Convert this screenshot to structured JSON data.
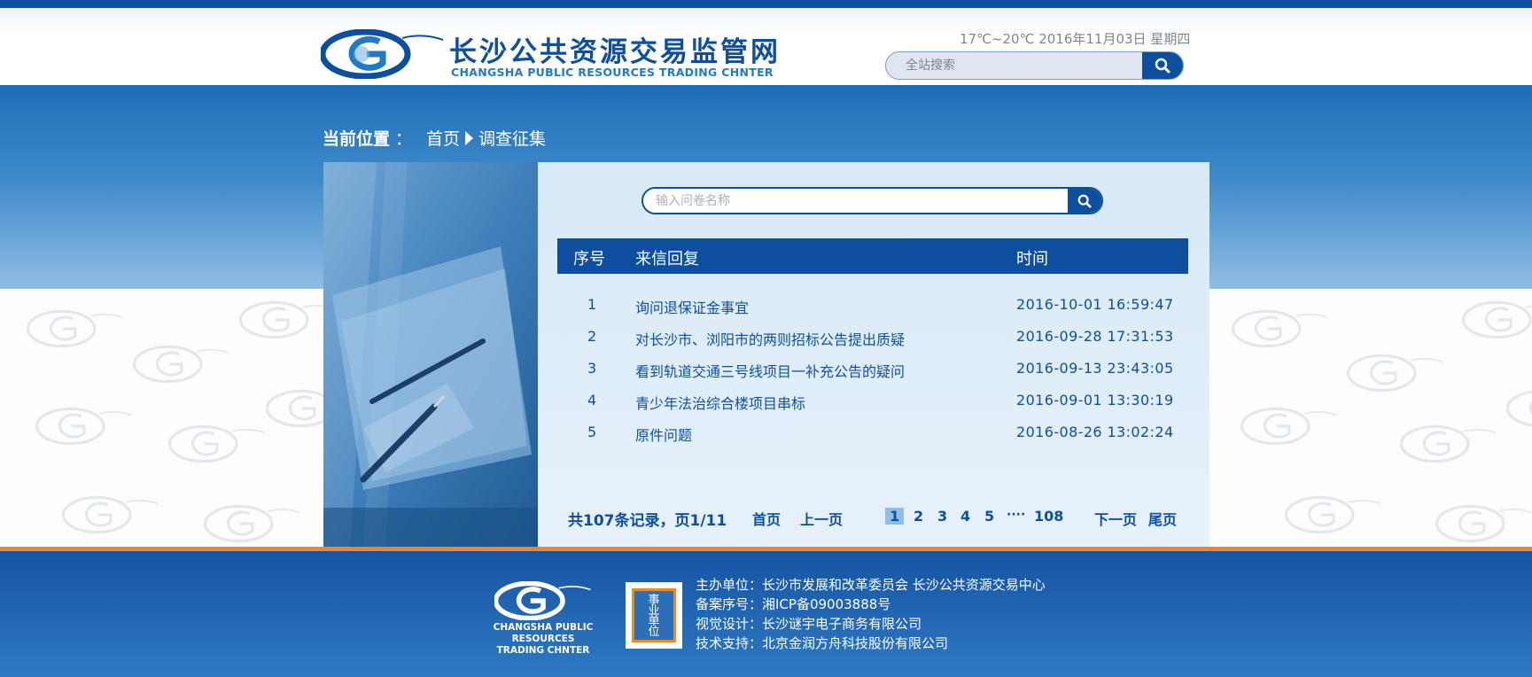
{
  "header": {
    "logo_cn": "长沙公共资源交易监管网",
    "logo_en": "CHANGSHA PUBLIC RESOURCES TRADING CHNTER",
    "weather_date": "17℃~20℃ 2016年11月03日 星期四",
    "site_search_placeholder": "全站搜索"
  },
  "breadcrumb": {
    "label": "当前位置",
    "separator": "：",
    "home": "首页",
    "current": "调查征集"
  },
  "content": {
    "search_placeholder": "输入问卷名称",
    "columns": {
      "no": "序号",
      "title": "来信回复",
      "time": "时间"
    },
    "rows": [
      {
        "no": "1",
        "title": "询问退保证金事宜",
        "time": "2016-10-01 16:59:47"
      },
      {
        "no": "2",
        "title": "对长沙市、浏阳市的两则招标公告提出质疑",
        "time": "2016-09-28 17:31:53"
      },
      {
        "no": "3",
        "title": "看到轨道交通三号线项目一补充公告的疑问",
        "time": "2016-09-13 23:43:05"
      },
      {
        "no": "4",
        "title": "青少年法治综合楼项目串标",
        "time": "2016-09-01 13:30:19"
      },
      {
        "no": "5",
        "title": "原件问题",
        "time": "2016-08-26 13:02:24"
      }
    ],
    "pagination": {
      "summary": "共107条记录，页1/11",
      "first": "首页",
      "prev": "上一页",
      "pages": [
        "1",
        "2",
        "3",
        "4",
        "5"
      ],
      "ellipsis": "····",
      "last_page": "108",
      "next": "下一页",
      "last": "尾页",
      "current_page": 1
    }
  },
  "footer": {
    "logo_en_line1": "CHANGSHA PUBLIC RESOURCES",
    "logo_en_line2": "TRADING CHNTER",
    "badge_text": "事业单位",
    "lines": [
      "主办单位：长沙市发展和改革委员会 长沙公共资源交易中心",
      "备案序号：湘ICP备09003888号",
      "视觉设计：长沙谜宇电子商务有限公司",
      "技术支持：北京金润方舟科技股份有限公司"
    ]
  },
  "colors": {
    "primary": "#0d4f9e",
    "accent_orange": "#e8892a",
    "panel_bg": "#dcecf8",
    "band_top": "#1e6db8"
  },
  "icons": {
    "search": "search-icon",
    "logo": "changsha-g-logo",
    "breadcrumb_arrow": "triangle-right-icon"
  }
}
